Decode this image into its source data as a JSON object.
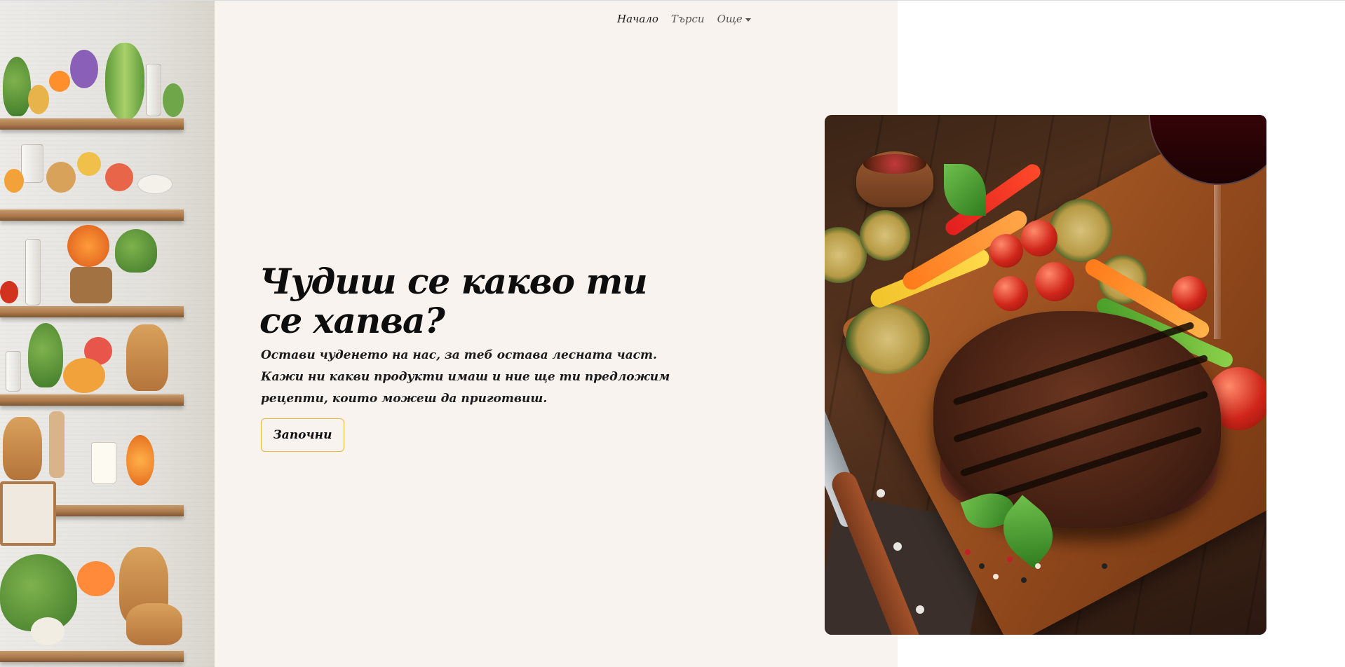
{
  "nav": {
    "items": [
      {
        "label": "Начало",
        "active": true
      },
      {
        "label": "Търси",
        "active": false
      },
      {
        "label": "Още",
        "dropdown": true
      }
    ]
  },
  "hero": {
    "title": "Чудиш се какво ти се хапва?",
    "subtitle": "Остави чудене​то на нас, за теб остава лесната част. Кажи ни какви продукти имаш и ние ще ти предложим рецепти, които можеш да приготвиш.",
    "cta_label": "Започни"
  },
  "colors": {
    "cream_panel": "#f8f3ef",
    "cta_border": "#e8b93a",
    "text": "#0d0d0d"
  },
  "icons": {
    "dropdown": "caret-down-icon"
  }
}
